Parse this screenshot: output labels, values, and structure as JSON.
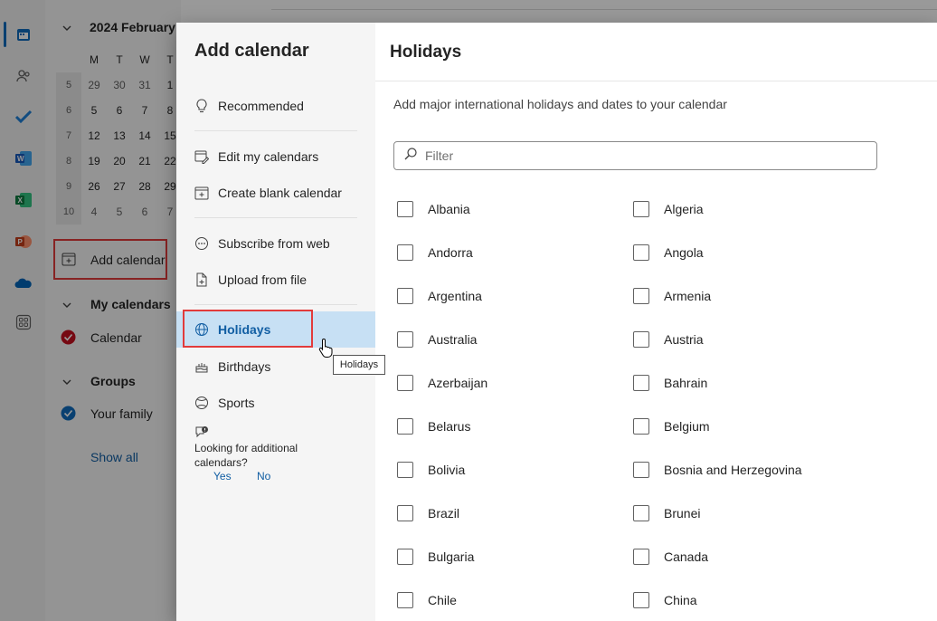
{
  "background": {
    "mini_calendar": {
      "month_label": "2024 February",
      "weekday_headers": [
        "M",
        "T",
        "W",
        "T"
      ],
      "weeks": [
        {
          "num": "5",
          "days": [
            "29",
            "30",
            "31",
            "1"
          ]
        },
        {
          "num": "6",
          "days": [
            "5",
            "6",
            "7",
            "8"
          ]
        },
        {
          "num": "7",
          "days": [
            "12",
            "13",
            "14",
            "15"
          ]
        },
        {
          "num": "8",
          "days": [
            "19",
            "20",
            "21",
            "22"
          ]
        },
        {
          "num": "9",
          "days": [
            "26",
            "27",
            "28",
            "29"
          ]
        },
        {
          "num": "10",
          "days": [
            "4",
            "5",
            "6",
            "7"
          ]
        }
      ]
    },
    "add_calendar_label": "Add calendar",
    "my_calendars_header": "My calendars",
    "calendar_item": "Calendar",
    "groups_header": "Groups",
    "group_item": "Your family",
    "show_all": "Show all"
  },
  "dialog": {
    "title": "Add calendar",
    "nav": {
      "recommended": "Recommended",
      "edit_my_calendars": "Edit my calendars",
      "create_blank": "Create blank calendar",
      "subscribe_web": "Subscribe from web",
      "upload_file": "Upload from file",
      "holidays": "Holidays",
      "birthdays": "Birthdays",
      "sports": "Sports"
    },
    "feedback": {
      "question": "Looking for additional calendars?",
      "yes": "Yes",
      "no": "No"
    },
    "tooltip": "Holidays",
    "content": {
      "title": "Holidays",
      "description": "Add major international holidays and dates to your calendar",
      "filter_placeholder": "Filter",
      "countries_left": [
        "Albania",
        "Andorra",
        "Argentina",
        "Australia",
        "Azerbaijan",
        "Belarus",
        "Bolivia",
        "Brazil",
        "Bulgaria",
        "Chile"
      ],
      "countries_right": [
        "Algeria",
        "Angola",
        "Armenia",
        "Austria",
        "Bahrain",
        "Belgium",
        "Bosnia and Herzegovina",
        "Brunei",
        "Canada",
        "China"
      ]
    }
  },
  "colors": {
    "accent": "#0f6cbd",
    "active_nav_bg": "#c7e0f4",
    "highlight_box": "#e23b3b",
    "calendar_red": "#c50f1f"
  }
}
